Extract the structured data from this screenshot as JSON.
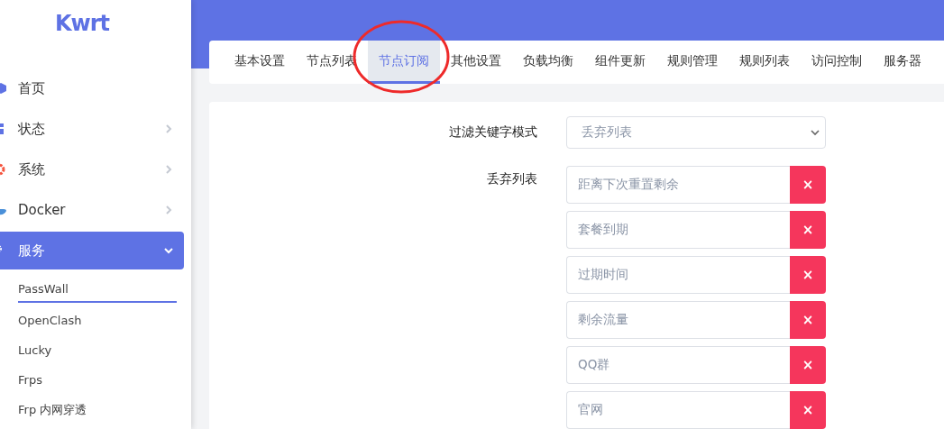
{
  "logo": "Kwrt",
  "menu": [
    {
      "label": "首页",
      "kind": "link",
      "selected": false
    },
    {
      "label": "状态",
      "kind": "group",
      "expanded": false,
      "selected": false
    },
    {
      "label": "系统",
      "kind": "group",
      "expanded": false,
      "selected": false
    },
    {
      "label": "Docker",
      "kind": "group",
      "expanded": false,
      "selected": false
    },
    {
      "label": "服务",
      "kind": "group",
      "expanded": true,
      "selected": true,
      "children": [
        {
          "label": "PassWall",
          "selected": true
        },
        {
          "label": "OpenClash",
          "selected": false
        },
        {
          "label": "Lucky",
          "selected": false
        },
        {
          "label": "Frps",
          "selected": false
        },
        {
          "label": "Frp 内网穿透",
          "selected": false
        }
      ]
    }
  ],
  "tabs": [
    {
      "label": "基本设置",
      "selected": false
    },
    {
      "label": "节点列表",
      "selected": false
    },
    {
      "label": "节点订阅",
      "selected": true
    },
    {
      "label": "其他设置",
      "selected": false
    },
    {
      "label": "负载均衡",
      "selected": false
    },
    {
      "label": "组件更新",
      "selected": false
    },
    {
      "label": "规则管理",
      "selected": false
    },
    {
      "label": "规则列表",
      "selected": false
    },
    {
      "label": "访问控制",
      "selected": false
    },
    {
      "label": "服务器",
      "selected": false
    }
  ],
  "form": {
    "mode_label": "过滤关键字模式",
    "mode_value": "丢弃列表",
    "list_label": "丢弃列表",
    "list": [
      {
        "value": "距离下次重置剩余",
        "remove": "×"
      },
      {
        "value": "套餐到期",
        "remove": "×"
      },
      {
        "value": "过期时间",
        "remove": "×"
      },
      {
        "value": "剩余流量",
        "remove": "×"
      },
      {
        "value": "QQ群",
        "remove": "×"
      },
      {
        "value": "官网",
        "remove": "×"
      }
    ]
  }
}
